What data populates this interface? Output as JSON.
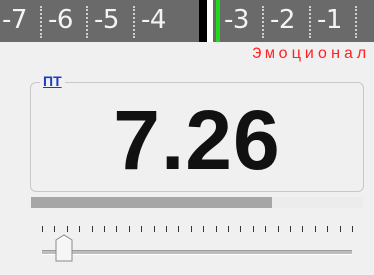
{
  "scale": {
    "ticks": [
      "-7",
      "-6",
      "-5",
      "-4",
      "-3",
      "-2",
      "-1"
    ],
    "indicator_color": "#20d81c"
  },
  "emotion_label": "Эмоционал",
  "panel": {
    "tab_label": "ПТ",
    "value": "7.26"
  },
  "progress": {
    "fraction": 0.726,
    "fill_color": "#a6a6a6"
  },
  "slider": {
    "position_fraction": 0.07
  },
  "colors": {
    "scale_background": "#6a6a6a",
    "emotion_text": "#ff2222",
    "tab_text": "#1a3cc8"
  }
}
